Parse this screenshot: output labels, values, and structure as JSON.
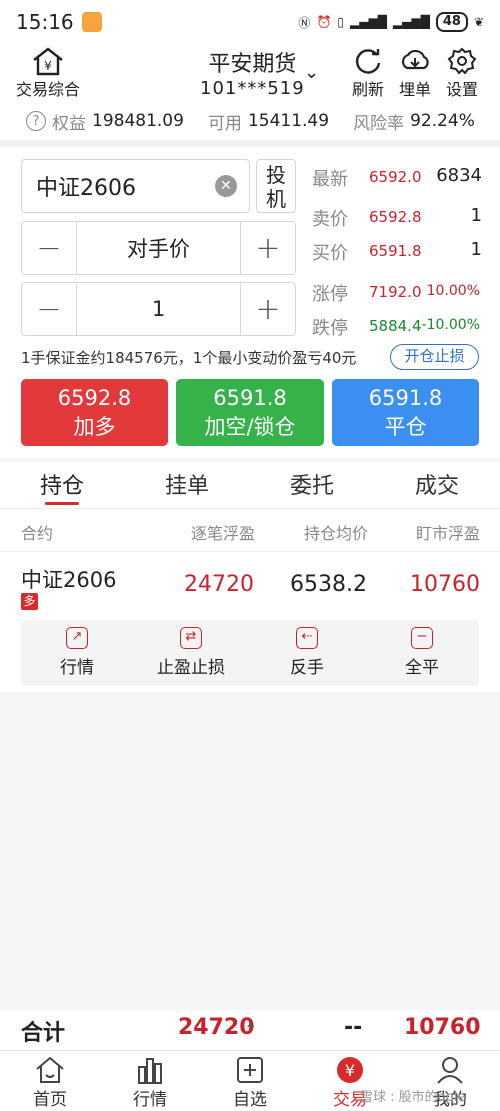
{
  "status": {
    "time": "15:16",
    "battery": "48"
  },
  "header": {
    "left_btn": "交易综合",
    "broker": "平安期货",
    "account": "101***519",
    "refresh": "刷新",
    "cloud": "埋单",
    "settings": "设置"
  },
  "account_bar": {
    "equity_label": "权益",
    "equity_value": "198481.09",
    "available_label": "可用",
    "available_value": "15411.49",
    "risk_label": "风险率",
    "risk_value": "92.24%"
  },
  "order": {
    "symbol": "中证2606",
    "kaiji_label": "投机",
    "price_mode": "对手价",
    "quantity": "1",
    "margin_info": "1手保证金约184576元，1个最小变动价盈亏40元",
    "stop_button": "开仓止损"
  },
  "quotes": [
    {
      "label": "最新",
      "price": "6592.0",
      "right": "6834"
    },
    {
      "label": "卖价",
      "price": "6592.8",
      "right": "1"
    },
    {
      "label": "买价",
      "price": "6591.8",
      "right": "1"
    },
    {
      "label": "涨停",
      "price": "7192.0",
      "right": "10.00%"
    },
    {
      "label": "跌停",
      "price": "5884.4",
      "right": "-10.00%"
    }
  ],
  "buttons": [
    {
      "price": "6592.8",
      "label": "加多",
      "color": "#e23a3a"
    },
    {
      "price": "6591.8",
      "label": "加空/锁仓",
      "color": "#35b24a"
    },
    {
      "price": "6591.8",
      "label": "平仓",
      "color": "#3a8ff0"
    }
  ],
  "tabs": [
    "持仓",
    "挂单",
    "委托",
    "成交"
  ],
  "table": {
    "headers": [
      "合约",
      "逐笔浮盈",
      "持仓均价",
      "盯市浮盈"
    ],
    "row": {
      "symbol": "中证2606",
      "direction": "多",
      "float_pl": "24720",
      "avg_price": "6538.2",
      "mtm_pl": "10760"
    }
  },
  "row_actions": [
    "行情",
    "止盈止损",
    "反手",
    "全平"
  ],
  "total": {
    "label": "合计",
    "float_pl": "24720",
    "avg_price": "--",
    "mtm_pl": "10760"
  },
  "nav": [
    "首页",
    "行情",
    "自选",
    "交易",
    "我的"
  ],
  "watermark": "雪球 : 股市的ople"
}
